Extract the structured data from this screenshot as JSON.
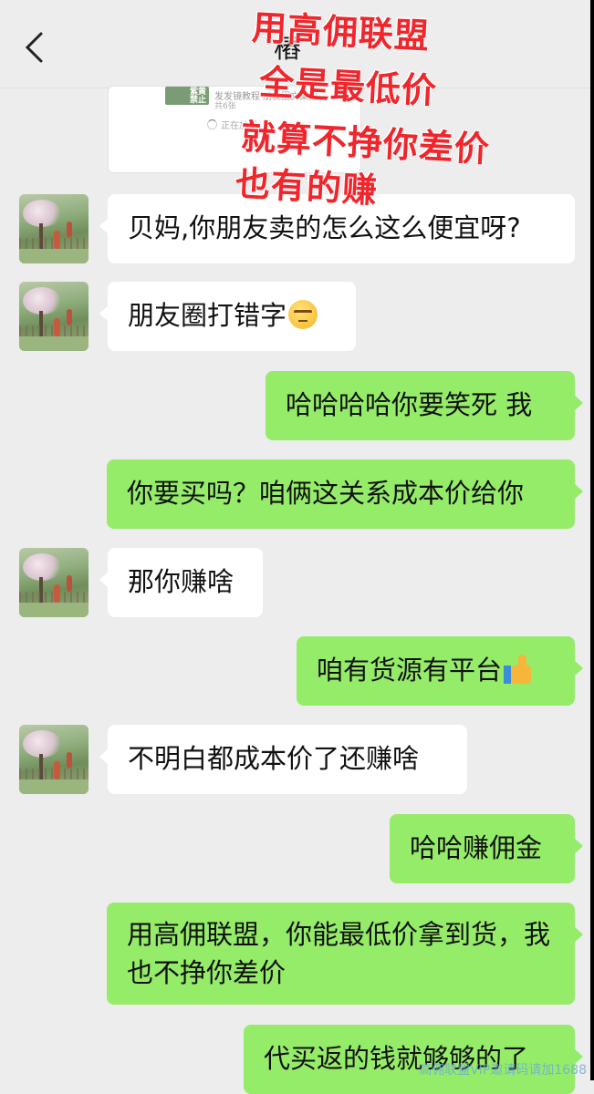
{
  "header": {
    "title": "樁",
    "back_icon": "chevron-left-icon"
  },
  "preview": {
    "thumb_label": "紫黄禁止",
    "text": "发发镜教程 朋友圈文案图",
    "count": "共6张",
    "loading_text": "正在加载"
  },
  "overlay": {
    "line1": "用高佣联盟",
    "line2": "全是最低价",
    "line3": "就算不挣你差价",
    "line4": "也有的赚",
    "color": "#f0262c"
  },
  "messages": [
    {
      "side": "left",
      "text": "贝妈,你朋友卖的怎么这么便宜呀?"
    },
    {
      "side": "left",
      "text": "朋友圈打错字",
      "emoji": "unamused-face-icon"
    },
    {
      "side": "right",
      "text": "哈哈哈哈你要笑死 我"
    },
    {
      "side": "right",
      "text": "你要买吗？咱俩这关系成本价给你"
    },
    {
      "side": "left",
      "text": "那你赚啥"
    },
    {
      "side": "right",
      "text": "咱有货源有平台",
      "emoji": "thumbs-up-icon"
    },
    {
      "side": "left",
      "text": "不明白都成本价了还赚啥"
    },
    {
      "side": "right",
      "text": "哈哈赚佣金"
    },
    {
      "side": "right",
      "text": "用高佣联盟，你能最低价拿到货，我也不挣你差价"
    },
    {
      "side": "right",
      "text": "代买返的钱就够够的了"
    }
  ],
  "colors": {
    "background": "#ededed",
    "bubble_sent": "#95ec69",
    "bubble_received": "#ffffff"
  },
  "watermark": "高佣联盟VIP邀请码请加1688"
}
